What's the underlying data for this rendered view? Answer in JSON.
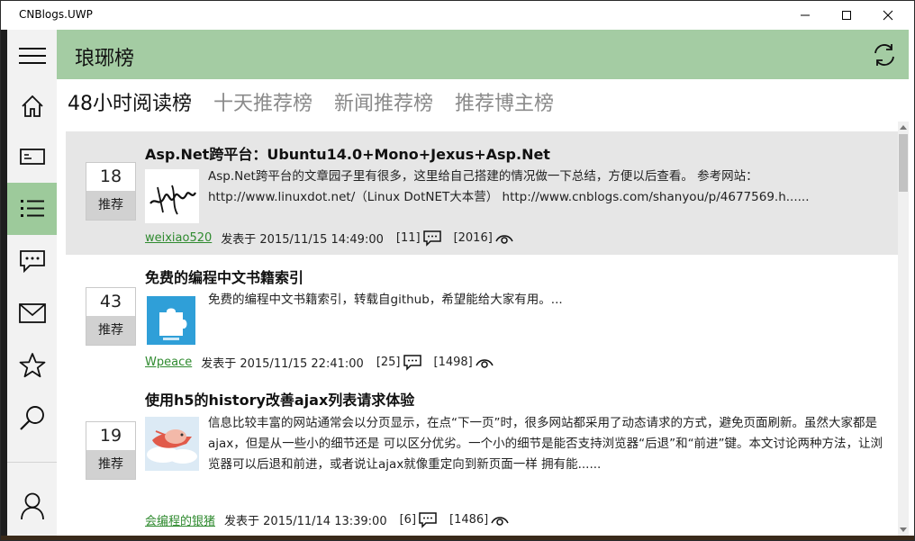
{
  "window": {
    "title": "CNBlogs.UWP",
    "minimize_icon": "minimize-icon",
    "maximize_icon": "maximize-icon",
    "close_icon": "close-icon"
  },
  "header": {
    "title": "琅琊榜",
    "refresh_icon": "refresh-icon",
    "color": "#a4cca3"
  },
  "nav": {
    "items": [
      {
        "name": "menu",
        "icon": "hamburger-icon"
      },
      {
        "name": "home",
        "icon": "home-icon"
      },
      {
        "name": "news",
        "icon": "news-card-icon"
      },
      {
        "name": "ranking",
        "icon": "list-icon",
        "active": true
      },
      {
        "name": "comments",
        "icon": "chat-icon"
      },
      {
        "name": "mail",
        "icon": "mail-icon"
      },
      {
        "name": "favorites",
        "icon": "star-icon"
      },
      {
        "name": "search",
        "icon": "search-icon"
      },
      {
        "name": "account",
        "icon": "user-icon"
      }
    ],
    "active_color": "#9dca9b"
  },
  "tabs": [
    {
      "label": "48小时阅读榜",
      "selected": true
    },
    {
      "label": "十天推荐榜",
      "selected": false
    },
    {
      "label": "新闻推荐榜",
      "selected": false
    },
    {
      "label": "推荐博主榜",
      "selected": false
    }
  ],
  "posts": [
    {
      "title": "Asp.Net跨平台：Ubuntu14.0+Mono+Jexus+Asp.Net",
      "votes": "18",
      "vote_label": "推荐",
      "summary": "Asp.Net跨平台的文章园子里有很多，这里给自己搭建的情况做一下总结，方便以后查看。 参考网站：http://www.linuxdot.net/（Linux DotNET大本营） http://www.cnblogs.com/shanyou/p/4677569.h......",
      "author": "weixiao520",
      "posted": "发表于 2015/11/15 14:49:00",
      "comments": "[11]",
      "views": "[2016]",
      "thumb": "signature-avatar",
      "highlighted": true
    },
    {
      "title": "免费的编程中文书籍索引",
      "votes": "43",
      "vote_label": "推荐",
      "summary": "免费的编程中文书籍索引，转载自github，希望能给大家有用。...",
      "author": "Wpeace",
      "posted": "发表于 2015/11/15 22:41:00",
      "comments": "[25]",
      "views": "[1498]",
      "thumb": "puzzle-avatar",
      "highlighted": false
    },
    {
      "title": "使用h5的history改善ajax列表请求体验",
      "votes": "19",
      "vote_label": "推荐",
      "summary": "信息比较丰富的网站通常会以分页显示，在点“下一页”时，很多网站都采用了动态请求的方式，避免页面刷新。虽然大家都是ajax，但是从一些小的细节还是 可以区分优劣。一个小的细节是能否支持浏览器“后退”和“前进”键。本文讨论两种方法，让浏览器可以后退和前进，或者说让ajax就像重定向到新页面一样 拥有能......",
      "author": "会编程的银猪",
      "posted": "发表于 2015/11/14 13:39:00",
      "comments": "[6]",
      "views": "[1486]",
      "thumb": "flying-pig-avatar",
      "highlighted": false
    }
  ]
}
